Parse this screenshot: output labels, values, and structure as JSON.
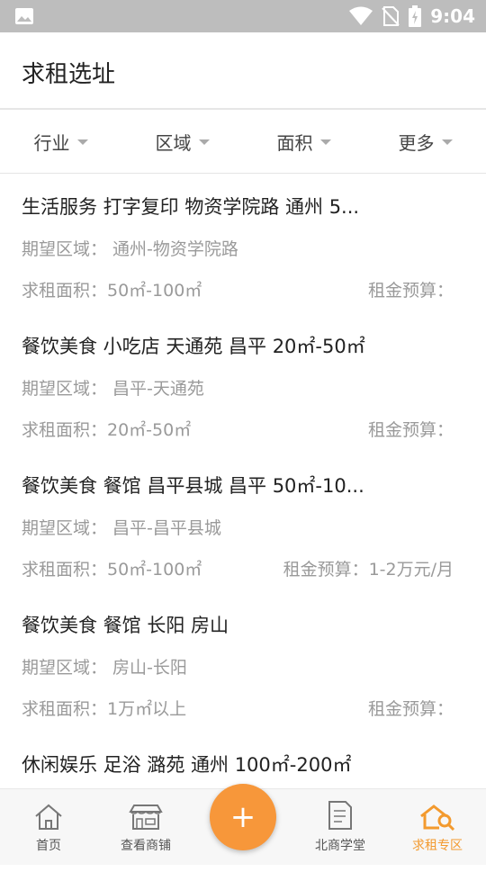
{
  "status_bar": {
    "time": "9:04"
  },
  "header": {
    "title": "求租选址"
  },
  "filters": [
    {
      "label": "行业"
    },
    {
      "label": "区域"
    },
    {
      "label": "面积"
    },
    {
      "label": "更多"
    }
  ],
  "listings": [
    {
      "title": "生活服务 打字复印 物资学院路 通州 5...",
      "region": "期望区域：  通州-物资学院路",
      "area": "求租面积：50㎡-100㎡",
      "budget": "租金预算："
    },
    {
      "title": "餐饮美食 小吃店 天通苑 昌平 20㎡-50㎡",
      "region": "期望区域：  昌平-天通苑",
      "area": "求租面积：20㎡-50㎡",
      "budget": "租金预算："
    },
    {
      "title": "餐饮美食 餐馆 昌平县城 昌平 50㎡-10...",
      "region": "期望区域：  昌平-昌平县城",
      "area": "求租面积：50㎡-100㎡",
      "budget": "租金预算：1-2万元/月"
    },
    {
      "title": "餐饮美食 餐馆 长阳 房山",
      "region": "期望区域：  房山-长阳",
      "area": "求租面积：1万㎡以上",
      "budget": "租金预算："
    },
    {
      "title": "休闲娱乐 足浴 潞苑 通州 100㎡-200㎡",
      "region": "",
      "area": "",
      "budget": ""
    }
  ],
  "tabbar": {
    "home": "首页",
    "shops": "查看商铺",
    "add": "+",
    "school": "北商学堂",
    "rent": "求租专区"
  },
  "colors": {
    "accent": "#f7973a",
    "active_tab": "#f39a2e"
  }
}
